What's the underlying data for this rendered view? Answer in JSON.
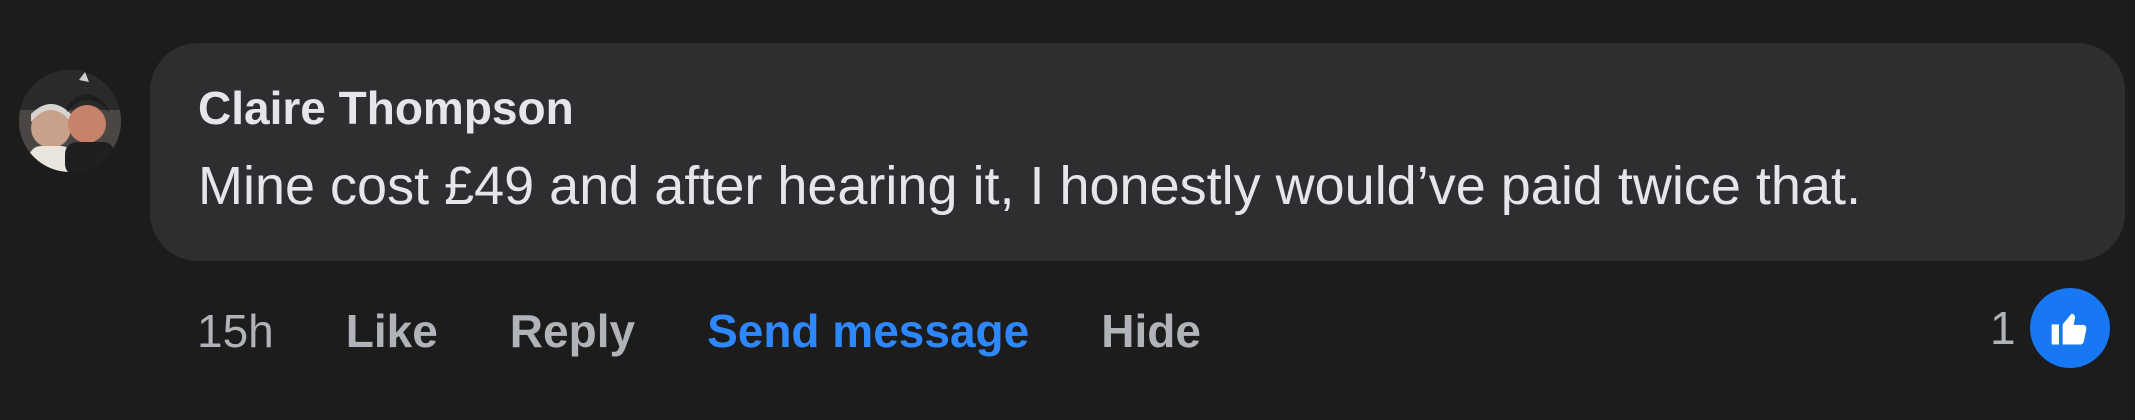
{
  "comment": {
    "author": "Claire Thompson",
    "text": "Mine cost £49 and after hearing it, I honestly would’ve paid twice that.",
    "avatar_icon": "avatar-photo-couple"
  },
  "actions": {
    "timestamp": "15h",
    "like_label": "Like",
    "reply_label": "Reply",
    "send_message_label": "Send message",
    "hide_label": "Hide"
  },
  "reactions": {
    "count": "1",
    "icon": "thumbs-up-icon"
  },
  "colors": {
    "background": "#1c1c1d",
    "bubble": "#2e2e30",
    "text": "#e4e6eb",
    "secondary_text": "#b0b3b8",
    "accent": "#2d88ff",
    "like_badge": "#1877f2"
  }
}
